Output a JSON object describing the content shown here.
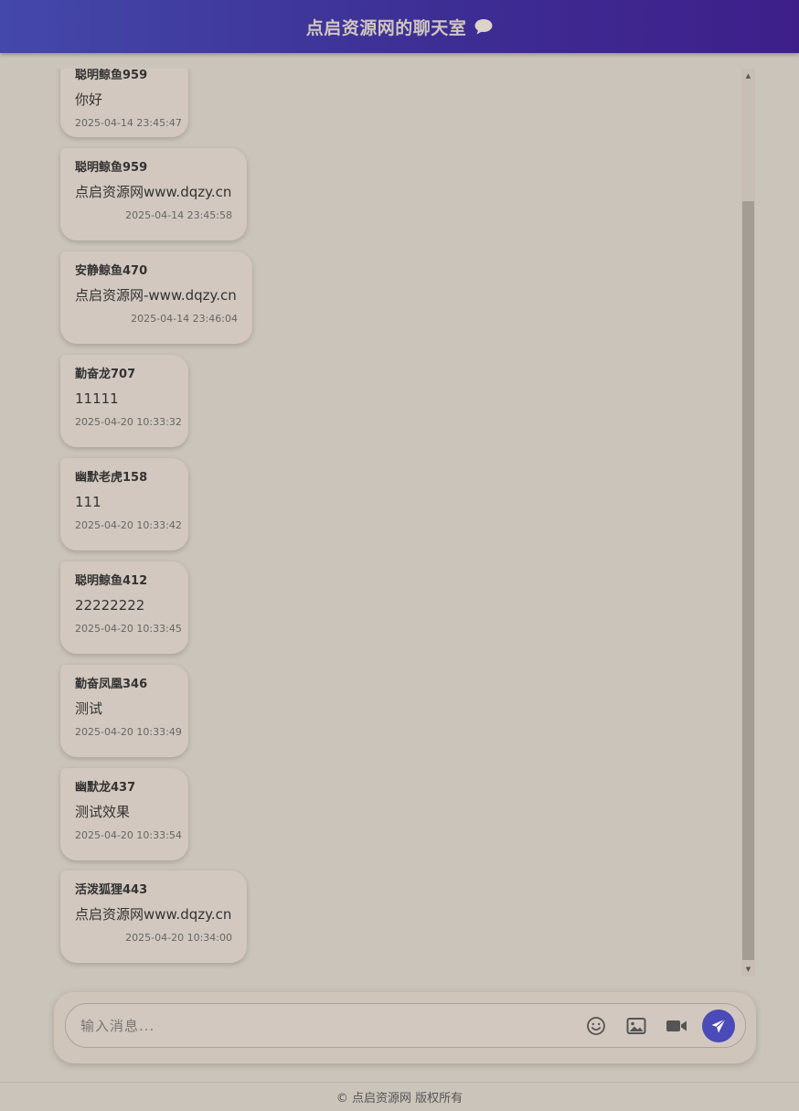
{
  "header": {
    "title": "点启资源网的聊天室",
    "icon": "speech-bubble-icon",
    "gradient": [
      "#4448aa",
      "#3e1f8a"
    ]
  },
  "messages": [
    {
      "sender": "聪明鲸鱼959",
      "text": "你好",
      "time": "2025-04-14 23:45:47"
    },
    {
      "sender": "聪明鲸鱼959",
      "text": "点启资源网www.dqzy.cn",
      "time": "2025-04-14 23:45:58"
    },
    {
      "sender": "安静鲸鱼470",
      "text": "点启资源网-www.dqzy.cn",
      "time": "2025-04-14 23:46:04"
    },
    {
      "sender": "勤奋龙707",
      "text": "11111",
      "time": "2025-04-20 10:33:32"
    },
    {
      "sender": "幽默老虎158",
      "text": "111",
      "time": "2025-04-20 10:33:42"
    },
    {
      "sender": "聪明鲸鱼412",
      "text": "22222222",
      "time": "2025-04-20 10:33:45"
    },
    {
      "sender": "勤奋凤凰346",
      "text": "测试",
      "time": "2025-04-20 10:33:49"
    },
    {
      "sender": "幽默龙437",
      "text": "测试效果",
      "time": "2025-04-20 10:33:54"
    },
    {
      "sender": "活泼狐狸443",
      "text": "点启资源网www.dqzy.cn",
      "time": "2025-04-20 10:34:00"
    }
  ],
  "composer": {
    "placeholder": "输入消息...",
    "value": "",
    "tools": [
      "emoji-icon",
      "image-icon",
      "video-icon"
    ],
    "send_icon": "paper-plane-icon",
    "send_color": "#4a4ab8"
  },
  "footer": {
    "text": "© 点启资源网 版权所有"
  }
}
